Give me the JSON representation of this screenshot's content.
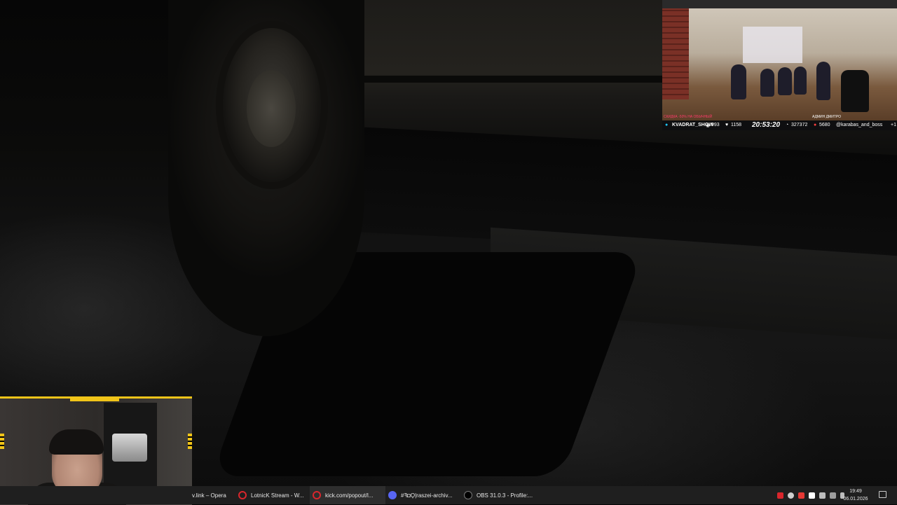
{
  "stream_overlay": {
    "channel": "KVADRAT_SHOW",
    "viewers": "993",
    "likes": "1158",
    "time": "20:53:20",
    "followers": "327372",
    "subs": "5680",
    "credit": "@karabas_and_boss",
    "plus": "+1",
    "caption_left": "СКИДКА -50% НА ОБЫЧНЫЙ",
    "caption_right": "АДМИН ДМИТРО"
  },
  "taskbar": {
    "items": [
      {
        "label": "v.link – Opera",
        "icon": "opera-icon"
      },
      {
        "label": "LotnicK Stream - W...",
        "icon": "opera-icon"
      },
      {
        "label": "kick.com/popout/l...",
        "icon": "opera-icon"
      },
      {
        "label": "#ꟻ◘Ϙ|raszei-archiv...",
        "icon": "discord-icon"
      },
      {
        "label": "OBS 31.0.3 - Profile:...",
        "icon": "obs-icon"
      }
    ],
    "clock_time": "19:49",
    "clock_date": "06.01.2026"
  },
  "colors": {
    "accent_yellow": "#f0c419",
    "taskbar_bg": "#1f1f1f"
  }
}
